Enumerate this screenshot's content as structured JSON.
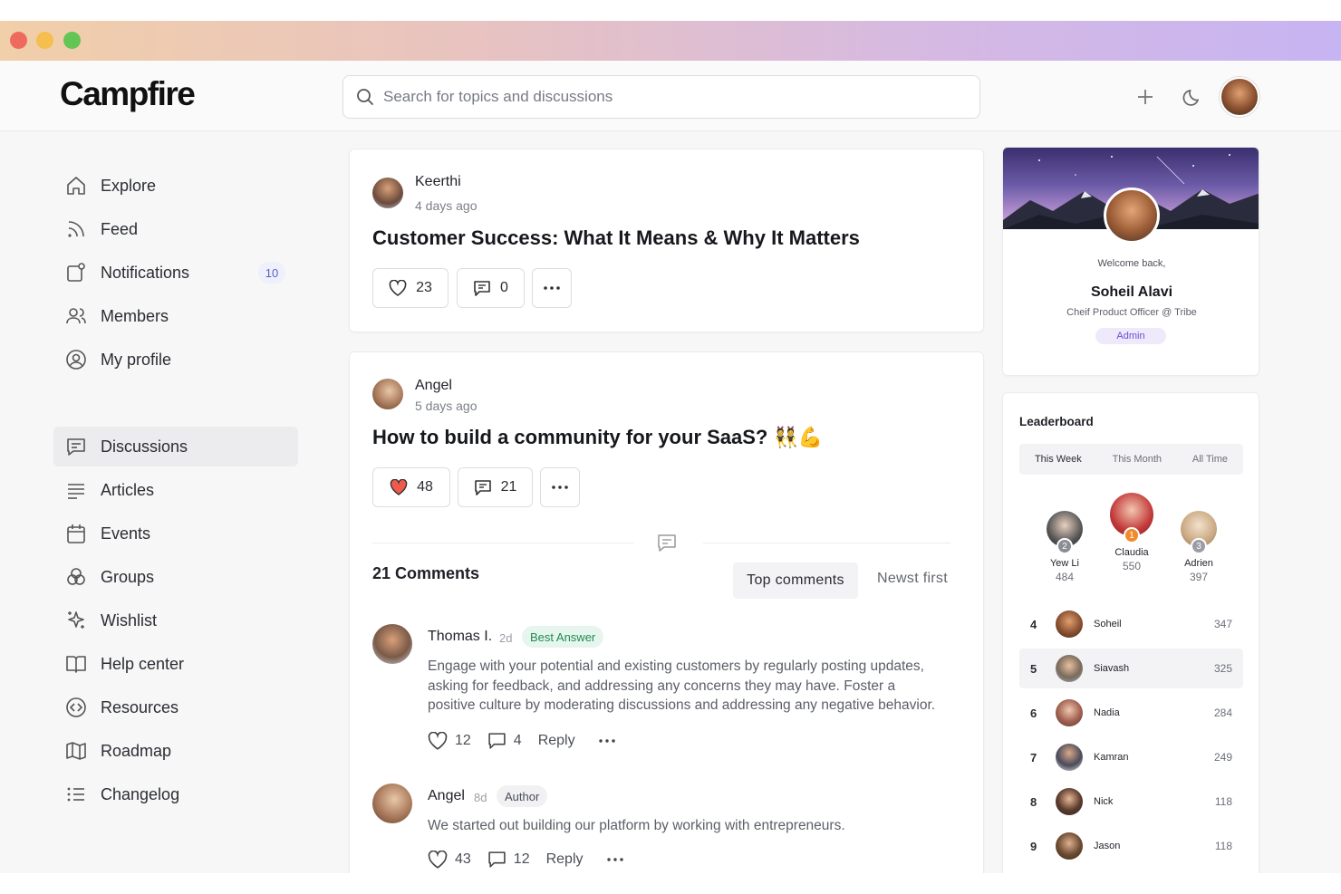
{
  "app": {
    "brand": "Campfire"
  },
  "header": {
    "search_placeholder": "Search for topics and discussions"
  },
  "sidebar": {
    "primary": [
      {
        "label": "Explore",
        "icon": "home-icon"
      },
      {
        "label": "Feed",
        "icon": "rss-icon"
      },
      {
        "label": "Notifications",
        "icon": "bell-icon",
        "badge": "10"
      },
      {
        "label": "Members",
        "icon": "users-icon"
      },
      {
        "label": "My profile",
        "icon": "user-circle-icon"
      }
    ],
    "spaces": [
      {
        "label": "Discussions",
        "icon": "chat-icon",
        "active": true
      },
      {
        "label": "Articles",
        "icon": "lines-icon"
      },
      {
        "label": "Events",
        "icon": "calendar-icon"
      },
      {
        "label": "Groups",
        "icon": "groups-icon"
      },
      {
        "label": "Wishlist",
        "icon": "sparkle-icon"
      },
      {
        "label": "Help center",
        "icon": "book-icon"
      },
      {
        "label": "Resources",
        "icon": "code-circle-icon"
      },
      {
        "label": "Roadmap",
        "icon": "map-icon"
      },
      {
        "label": "Changelog",
        "icon": "list-icon"
      }
    ]
  },
  "posts": [
    {
      "author": "Keerthi",
      "time": "4 days ago",
      "title": "Customer Success: What It Means & Why It Matters",
      "likes": "23",
      "comments": "0"
    },
    {
      "author": "Angel",
      "time": "5 days ago",
      "title": "How to build a community for your SaaS? 👯💪",
      "likes": "48",
      "comments": "21",
      "comments_heading": "21 Comments",
      "sort_top": "Top comments",
      "sort_newest": "Newst first",
      "comment_list": [
        {
          "name": "Thomas I.",
          "time": "2d",
          "tag": "Best Answer",
          "body_lines": [
            "Engage with your potential and existing customers by regularly posting updates,",
            "asking for feedback, and addressing any concerns they may have. Foster a",
            "positive culture by moderating discussions and addressing any negative behavior."
          ],
          "likes": "12",
          "replies": "4",
          "reply_label": "Reply"
        },
        {
          "name": "Angel",
          "time": "8d",
          "tag": "Author",
          "body_lines": [
            "We started out building our platform by working with entrepreneurs."
          ],
          "likes": "43",
          "replies": "12",
          "reply_label": "Reply"
        }
      ]
    }
  ],
  "profile": {
    "welcome": "Welcome back,",
    "name": "Soheil Alavi",
    "role": "Cheif Product Officer @ Tribe",
    "badge": "Admin"
  },
  "leaderboard": {
    "title": "Leaderboard",
    "tabs": [
      "This Week",
      "This Month",
      "All Time"
    ],
    "podium": [
      {
        "rank": "2",
        "name": "Yew Li",
        "score": "484"
      },
      {
        "rank": "1",
        "name": "Claudia",
        "score": "550"
      },
      {
        "rank": "3",
        "name": "Adrien",
        "score": "397"
      }
    ],
    "rows": [
      {
        "rank": "4",
        "name": "Soheil",
        "score": "347"
      },
      {
        "rank": "5",
        "name": "Siavash",
        "score": "325"
      },
      {
        "rank": "6",
        "name": "Nadia",
        "score": "284"
      },
      {
        "rank": "7",
        "name": "Kamran",
        "score": "249"
      },
      {
        "rank": "8",
        "name": "Nick",
        "score": "118"
      },
      {
        "rank": "9",
        "name": "Jason",
        "score": "118"
      }
    ]
  },
  "colors": {
    "accent": "#5b5fc7",
    "like_active": "#f05a4a",
    "best_answer": "#1f8a52",
    "admin_badge": "#6f4ad6"
  }
}
